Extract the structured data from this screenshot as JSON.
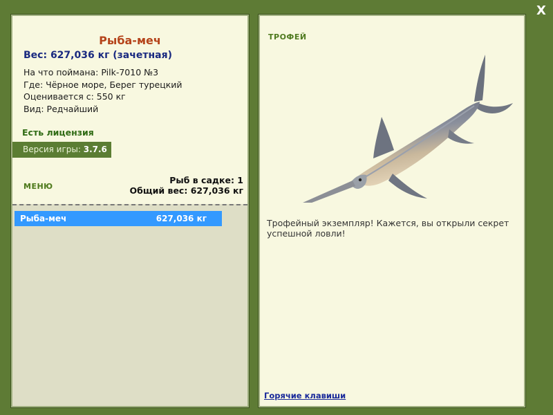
{
  "window": {
    "close_label": "X"
  },
  "fish": {
    "title": "Рыба-меч",
    "weight_line": "Вес: 627,036 кг (зачетная)",
    "bait_line": "На что поймана: Pilk-7010 №3",
    "place_line": "Где: Чёрное море, Берег турецкий",
    "value_line": "Оценивается с: 550 кг",
    "kind_line": "Вид: Редчайший"
  },
  "license_label": "Есть лицензия",
  "version": {
    "label": "Версия игры:",
    "value": "3.7.6"
  },
  "menu_label": "МЕНЮ",
  "keepnet": {
    "count_line": "Рыб в садке: 1",
    "total_line": "Общий вес: 627,036 кг"
  },
  "catch_list": [
    {
      "name": "Рыба-меч",
      "weight": "627,036 кг"
    }
  ],
  "trophy": {
    "label": "ТРОФЕЙ",
    "text": "Трофейный экземпляр! Кажется, вы открыли секрет успешной ловли!"
  },
  "hotkeys_label": "Горячие клавиши",
  "colors": {
    "background": "#5e7b35",
    "panel": "#f8f8e0",
    "selection": "#3399ff",
    "title": "#b5441b"
  },
  "icons": {
    "fish_image": "swordfish-image",
    "close": "close-icon"
  }
}
